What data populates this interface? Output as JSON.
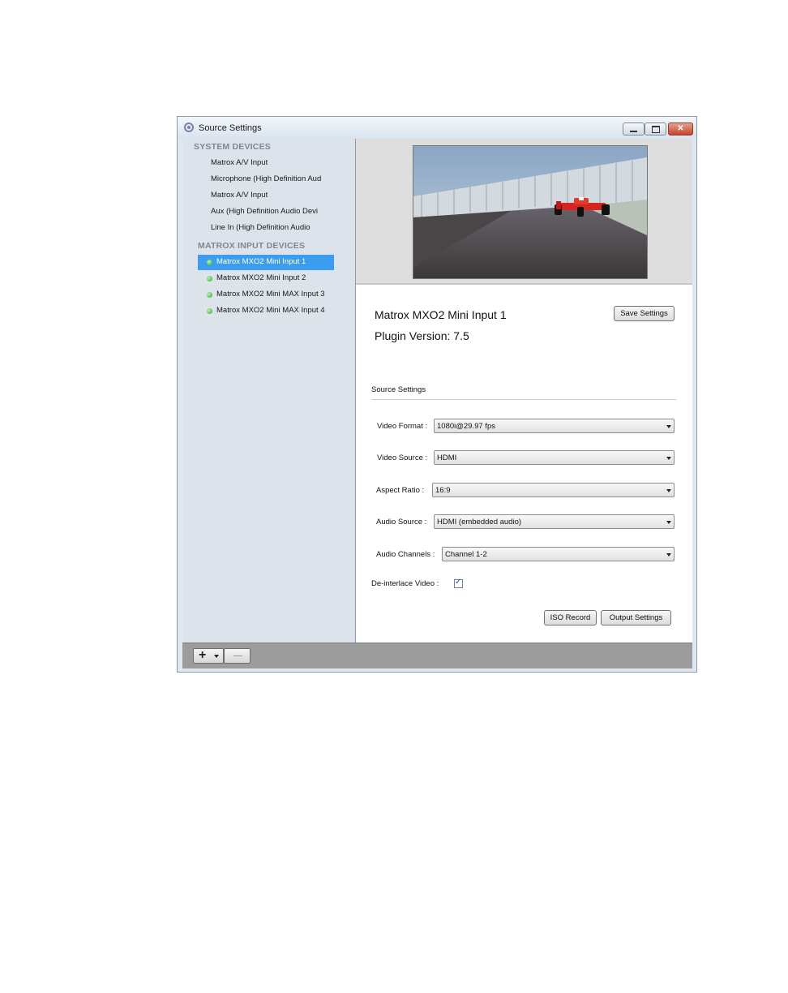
{
  "window": {
    "title": "Source Settings"
  },
  "sidebar": {
    "system_header": "SYSTEM DEVICES",
    "system_devices": [
      "Matrox A/V Input",
      "Microphone (High Definition Aud",
      "Matrox A/V  Input",
      "Aux (High Definition Audio Devi",
      "Line In (High Definition Audio"
    ],
    "matrox_header": "MATROX INPUT DEVICES",
    "matrox_devices": [
      {
        "label": "Matrox MXO2 Mini Input 1",
        "selected": true,
        "status": "connected"
      },
      {
        "label": "Matrox MXO2 Mini Input 2",
        "selected": false,
        "status": "connected"
      },
      {
        "label": "Matrox MXO2 Mini MAX Input 3",
        "selected": false,
        "status": "connected"
      },
      {
        "label": "Matrox MXO2 Mini MAX Input 4",
        "selected": false,
        "status": "connected"
      }
    ]
  },
  "details": {
    "device_name": "Matrox MXO2 Mini Input 1",
    "plugin_version": "Plugin Version: 7.5",
    "save_label": "Save Settings",
    "group_label": "Source Settings",
    "fields": [
      {
        "label": "Video Format :",
        "value": "1080i@29.97 fps"
      },
      {
        "label": "Video Source :",
        "value": "HDMI"
      },
      {
        "label": "Aspect Ratio :",
        "value": "16:9"
      },
      {
        "label": "Audio Source :",
        "value": "HDMI (embedded audio)"
      },
      {
        "label": "Audio Channels :",
        "value": "Channel 1-2"
      }
    ],
    "deinterlace_label": "De-interlace Video :",
    "deinterlace_checked": true,
    "iso_label": "ISO Record",
    "output_label": "Output Settings"
  },
  "colors": {
    "selection": "#3c9cf0",
    "status_dot": "#23a827",
    "panel_bg": "#dce3eb"
  }
}
